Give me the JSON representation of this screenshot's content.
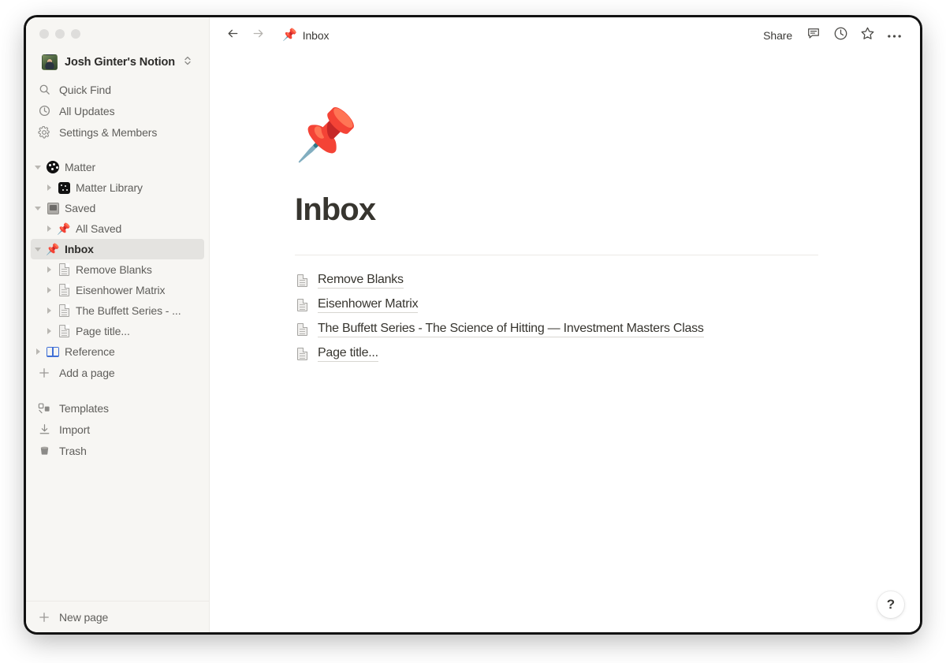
{
  "window": {
    "traffic_lights": [
      "close",
      "minimize",
      "zoom"
    ]
  },
  "sidebar": {
    "workspace": {
      "name": "Josh Ginter's Notion",
      "avatar": "user-avatar-photo",
      "switcher_icon": "chevron-up-down-icon"
    },
    "nav": [
      {
        "label": "Quick Find",
        "icon": "search-icon"
      },
      {
        "label": "All Updates",
        "icon": "clock-icon"
      },
      {
        "label": "Settings & Members",
        "icon": "gear-icon"
      }
    ],
    "tree": [
      {
        "label": "Matter",
        "icon": "matter-logo-icon",
        "expanded": true,
        "level": 1,
        "selected": false
      },
      {
        "label": "Matter Library",
        "icon": "matter-library-icon",
        "expanded": false,
        "level": 2,
        "selected": false
      },
      {
        "label": "Saved",
        "icon": "card-index-dividers-icon",
        "expanded": true,
        "level": 1,
        "selected": false
      },
      {
        "label": "All Saved",
        "icon": "pushpin-icon",
        "expanded": false,
        "level": 2,
        "selected": false
      },
      {
        "label": "Inbox",
        "icon": "pushpin-icon",
        "expanded": true,
        "level": 1,
        "selected": true
      },
      {
        "label": "Remove Blanks",
        "icon": "page-icon",
        "expanded": false,
        "level": 2,
        "selected": false
      },
      {
        "label": "Eisenhower Matrix",
        "icon": "page-icon",
        "expanded": false,
        "level": 2,
        "selected": false
      },
      {
        "label": "The Buffett Series - ...",
        "icon": "page-icon",
        "expanded": false,
        "level": 2,
        "selected": false
      },
      {
        "label": "Page title...",
        "icon": "page-icon",
        "expanded": false,
        "level": 2,
        "selected": false
      },
      {
        "label": "Reference",
        "icon": "open-book-icon",
        "expanded": false,
        "level": 1,
        "selected": false
      }
    ],
    "add_page": {
      "label": "Add a page",
      "icon": "plus-icon"
    },
    "tools": [
      {
        "label": "Templates",
        "icon": "templates-icon"
      },
      {
        "label": "Import",
        "icon": "import-download-icon"
      },
      {
        "label": "Trash",
        "icon": "trash-icon"
      }
    ],
    "footer": {
      "label": "New page",
      "icon": "plus-icon"
    }
  },
  "topbar": {
    "back_icon": "arrow-left-icon",
    "forward_icon": "arrow-right-icon",
    "breadcrumb": {
      "emoji": "📌",
      "text": "Inbox"
    },
    "share_label": "Share",
    "comment_icon": "comment-icon",
    "updates_icon": "clock-icon",
    "favorite_icon": "star-icon",
    "more_icon": "ellipsis-icon"
  },
  "page": {
    "emoji": "📌",
    "title": "Inbox",
    "items": [
      {
        "icon": "page-icon",
        "title": "Remove Blanks"
      },
      {
        "icon": "page-icon",
        "title": "Eisenhower Matrix"
      },
      {
        "icon": "page-icon",
        "title": "The Buffett Series - The Science of Hitting — Investment Masters Class"
      },
      {
        "icon": "page-icon",
        "title": "Page title..."
      }
    ]
  },
  "help": {
    "label": "?"
  },
  "colors": {
    "sidebar_bg": "#f7f6f3",
    "selected_row": "#e4e3e0",
    "text_primary": "#37352f",
    "text_secondary": "#5f5e5b",
    "accent_red": "#e02020"
  }
}
